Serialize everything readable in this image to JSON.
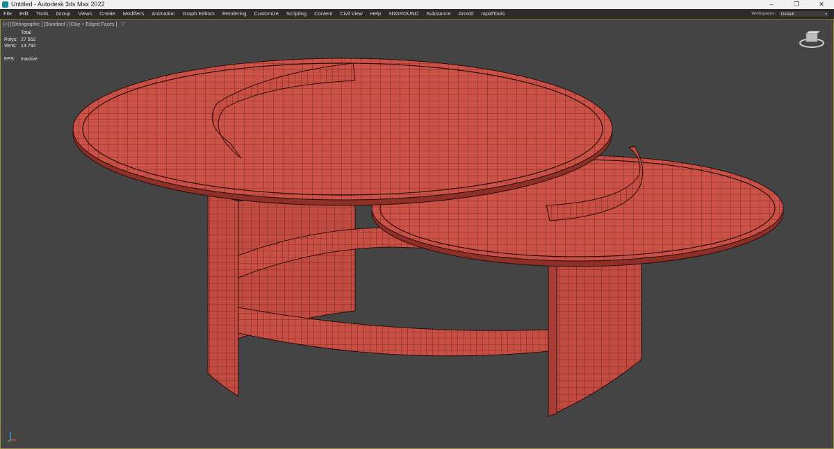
{
  "window": {
    "title": "Untitled - Autodesk 3ds Max 2022",
    "controls": {
      "minimize": "–",
      "restore": "❐",
      "close": "✕"
    }
  },
  "menubar": {
    "items": [
      "File",
      "Edit",
      "Tools",
      "Group",
      "Views",
      "Create",
      "Modifiers",
      "Animation",
      "Graph Editors",
      "Rendering",
      "Customize",
      "Scripting",
      "Content",
      "Civil View",
      "Help",
      "3DGROUND",
      "Substance",
      "Arnold",
      "rapidTools"
    ],
    "workspace_label": "Workspaces:",
    "workspace_value": "Default"
  },
  "viewport": {
    "label": "[+] [Orthographic ] [Standard ] [Clay + Edged Faces ]",
    "stats": {
      "header": "Total",
      "polys_label": "Polys:",
      "polys_value": "27 552",
      "verts_label": "Verts:",
      "verts_value": "13 792",
      "fps_label": "FPS:",
      "fps_value": "Inactive"
    },
    "colors": {
      "background": "#444444",
      "mesh_fill": "#cc5248",
      "mesh_wire": "#3a120e",
      "border_active": "#9c8f3b"
    }
  },
  "icons": {
    "filter": "filter-icon",
    "viewcube": "viewcube-icon",
    "axis": "axis-tripod-icon"
  }
}
